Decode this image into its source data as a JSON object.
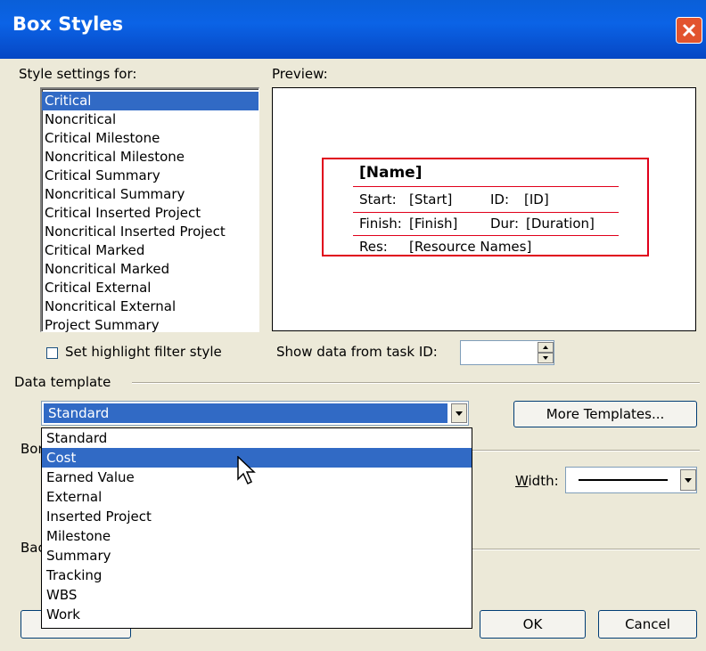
{
  "window": {
    "title": "Box Styles"
  },
  "style_settings": {
    "label": "Style settings for:",
    "items": [
      "Critical",
      "Noncritical",
      "Critical Milestone",
      "Noncritical Milestone",
      "Critical Summary",
      "Noncritical Summary",
      "Critical Inserted Project",
      "Noncritical Inserted Project",
      "Critical Marked",
      "Noncritical Marked",
      "Critical External",
      "Noncritical External",
      "Project Summary"
    ],
    "selected": "Critical"
  },
  "preview": {
    "label": "Preview:",
    "name": "[Name]",
    "row1_left_label": "Start:",
    "row1_left_value": "[Start]",
    "row1_right_label": "ID:",
    "row1_right_value": "[ID]",
    "row2_left_label": "Finish:",
    "row2_left_value": "[Finish]",
    "row2_right_label": "Dur:",
    "row2_right_value": "[Duration]",
    "row3_label": "Res:",
    "row3_value": "[Resource Names]",
    "border_color": "#e0001b"
  },
  "highlight": {
    "label": "Set highlight filter style",
    "checked": false
  },
  "show_data": {
    "label": "Show data from task ID:",
    "value": ""
  },
  "data_template": {
    "group_label": "Data template",
    "selected": "Standard",
    "options": [
      "Standard",
      "Cost",
      "Earned Value",
      "External",
      "Inserted Project",
      "Milestone",
      "Summary",
      "Tracking",
      "WBS",
      "Work"
    ],
    "hovered": "Cost",
    "more_button": "More Templates..."
  },
  "border": {
    "group_label_partial": "Bor",
    "width_label": "Width:"
  },
  "background": {
    "group_label_partial": "Bac"
  },
  "buttons": {
    "ok": "OK",
    "cancel": "Cancel"
  },
  "colors": {
    "selection": "#316ac5",
    "titlebar": "#0a5fd8",
    "dialog_bg": "#ece9d8"
  }
}
